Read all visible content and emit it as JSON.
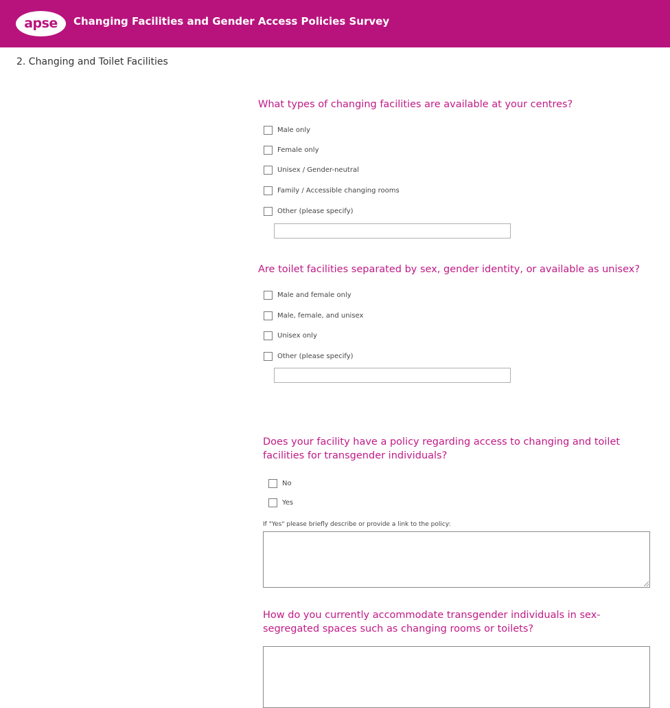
{
  "header": {
    "logo_text": "apse",
    "title": "Changing Facilities and Gender Access Policies Survey",
    "background_color": "#b8137d"
  },
  "page": {
    "title": "2. Changing and Toilet Facilities"
  },
  "q1": {
    "text": "What types of changing facilities are available at your centres?",
    "options": [
      "Male only",
      "Female only",
      "Unisex / Gender-neutral",
      "Family / Accessible changing rooms",
      "Other (please specify)"
    ],
    "other_value": ""
  },
  "q2": {
    "text": "Are toilet facilities separated by sex, gender identity, or available as unisex?",
    "options": [
      "Male and female only",
      "Male, female, and unisex",
      "Unisex only",
      "Other (please specify)"
    ],
    "other_value": ""
  },
  "q3": {
    "text_line1": "Does your facility have a policy regarding access to changing and toilet",
    "text_line2": "facilities for transgender individuals?",
    "options": [
      "No",
      "Yes"
    ],
    "followup_label": "If \"Yes\" please briefly describe or provide a link to the policy:",
    "followup_value": ""
  },
  "q4": {
    "text_line1": "How do you currently accommodate transgender individuals in sex-",
    "text_line2": "segregated spaces such as changing rooms or toilets?",
    "answer_value": ""
  },
  "colors": {
    "accent": "#c01a86"
  }
}
